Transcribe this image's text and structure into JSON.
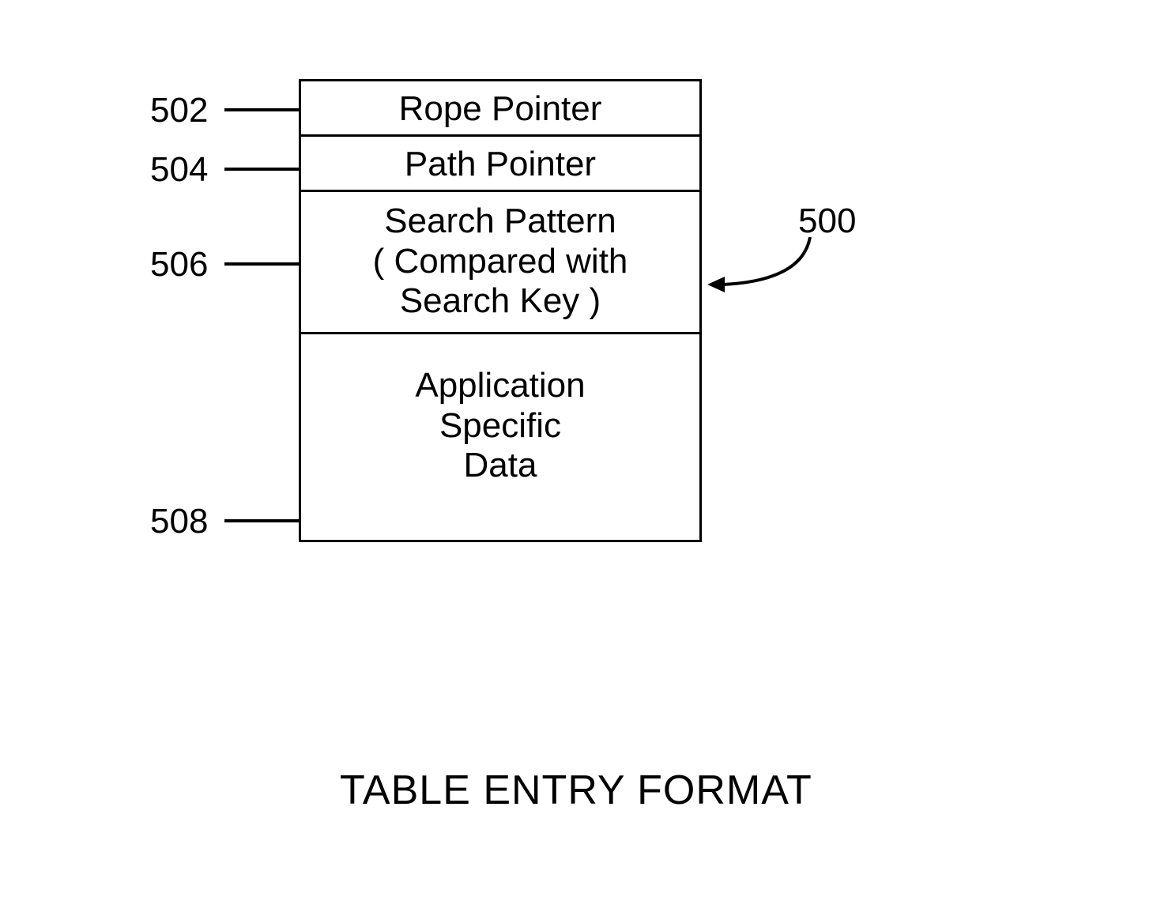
{
  "diagram": {
    "title": "TABLE ENTRY FORMAT",
    "ref_number": "500",
    "rows": [
      {
        "ref": "502",
        "text": "Rope Pointer"
      },
      {
        "ref": "504",
        "text": "Path Pointer"
      },
      {
        "ref": "506",
        "text": "Search Pattern\n( Compared with\nSearch Key )"
      },
      {
        "ref": "508",
        "text": "Application\nSpecific\nData"
      }
    ]
  }
}
